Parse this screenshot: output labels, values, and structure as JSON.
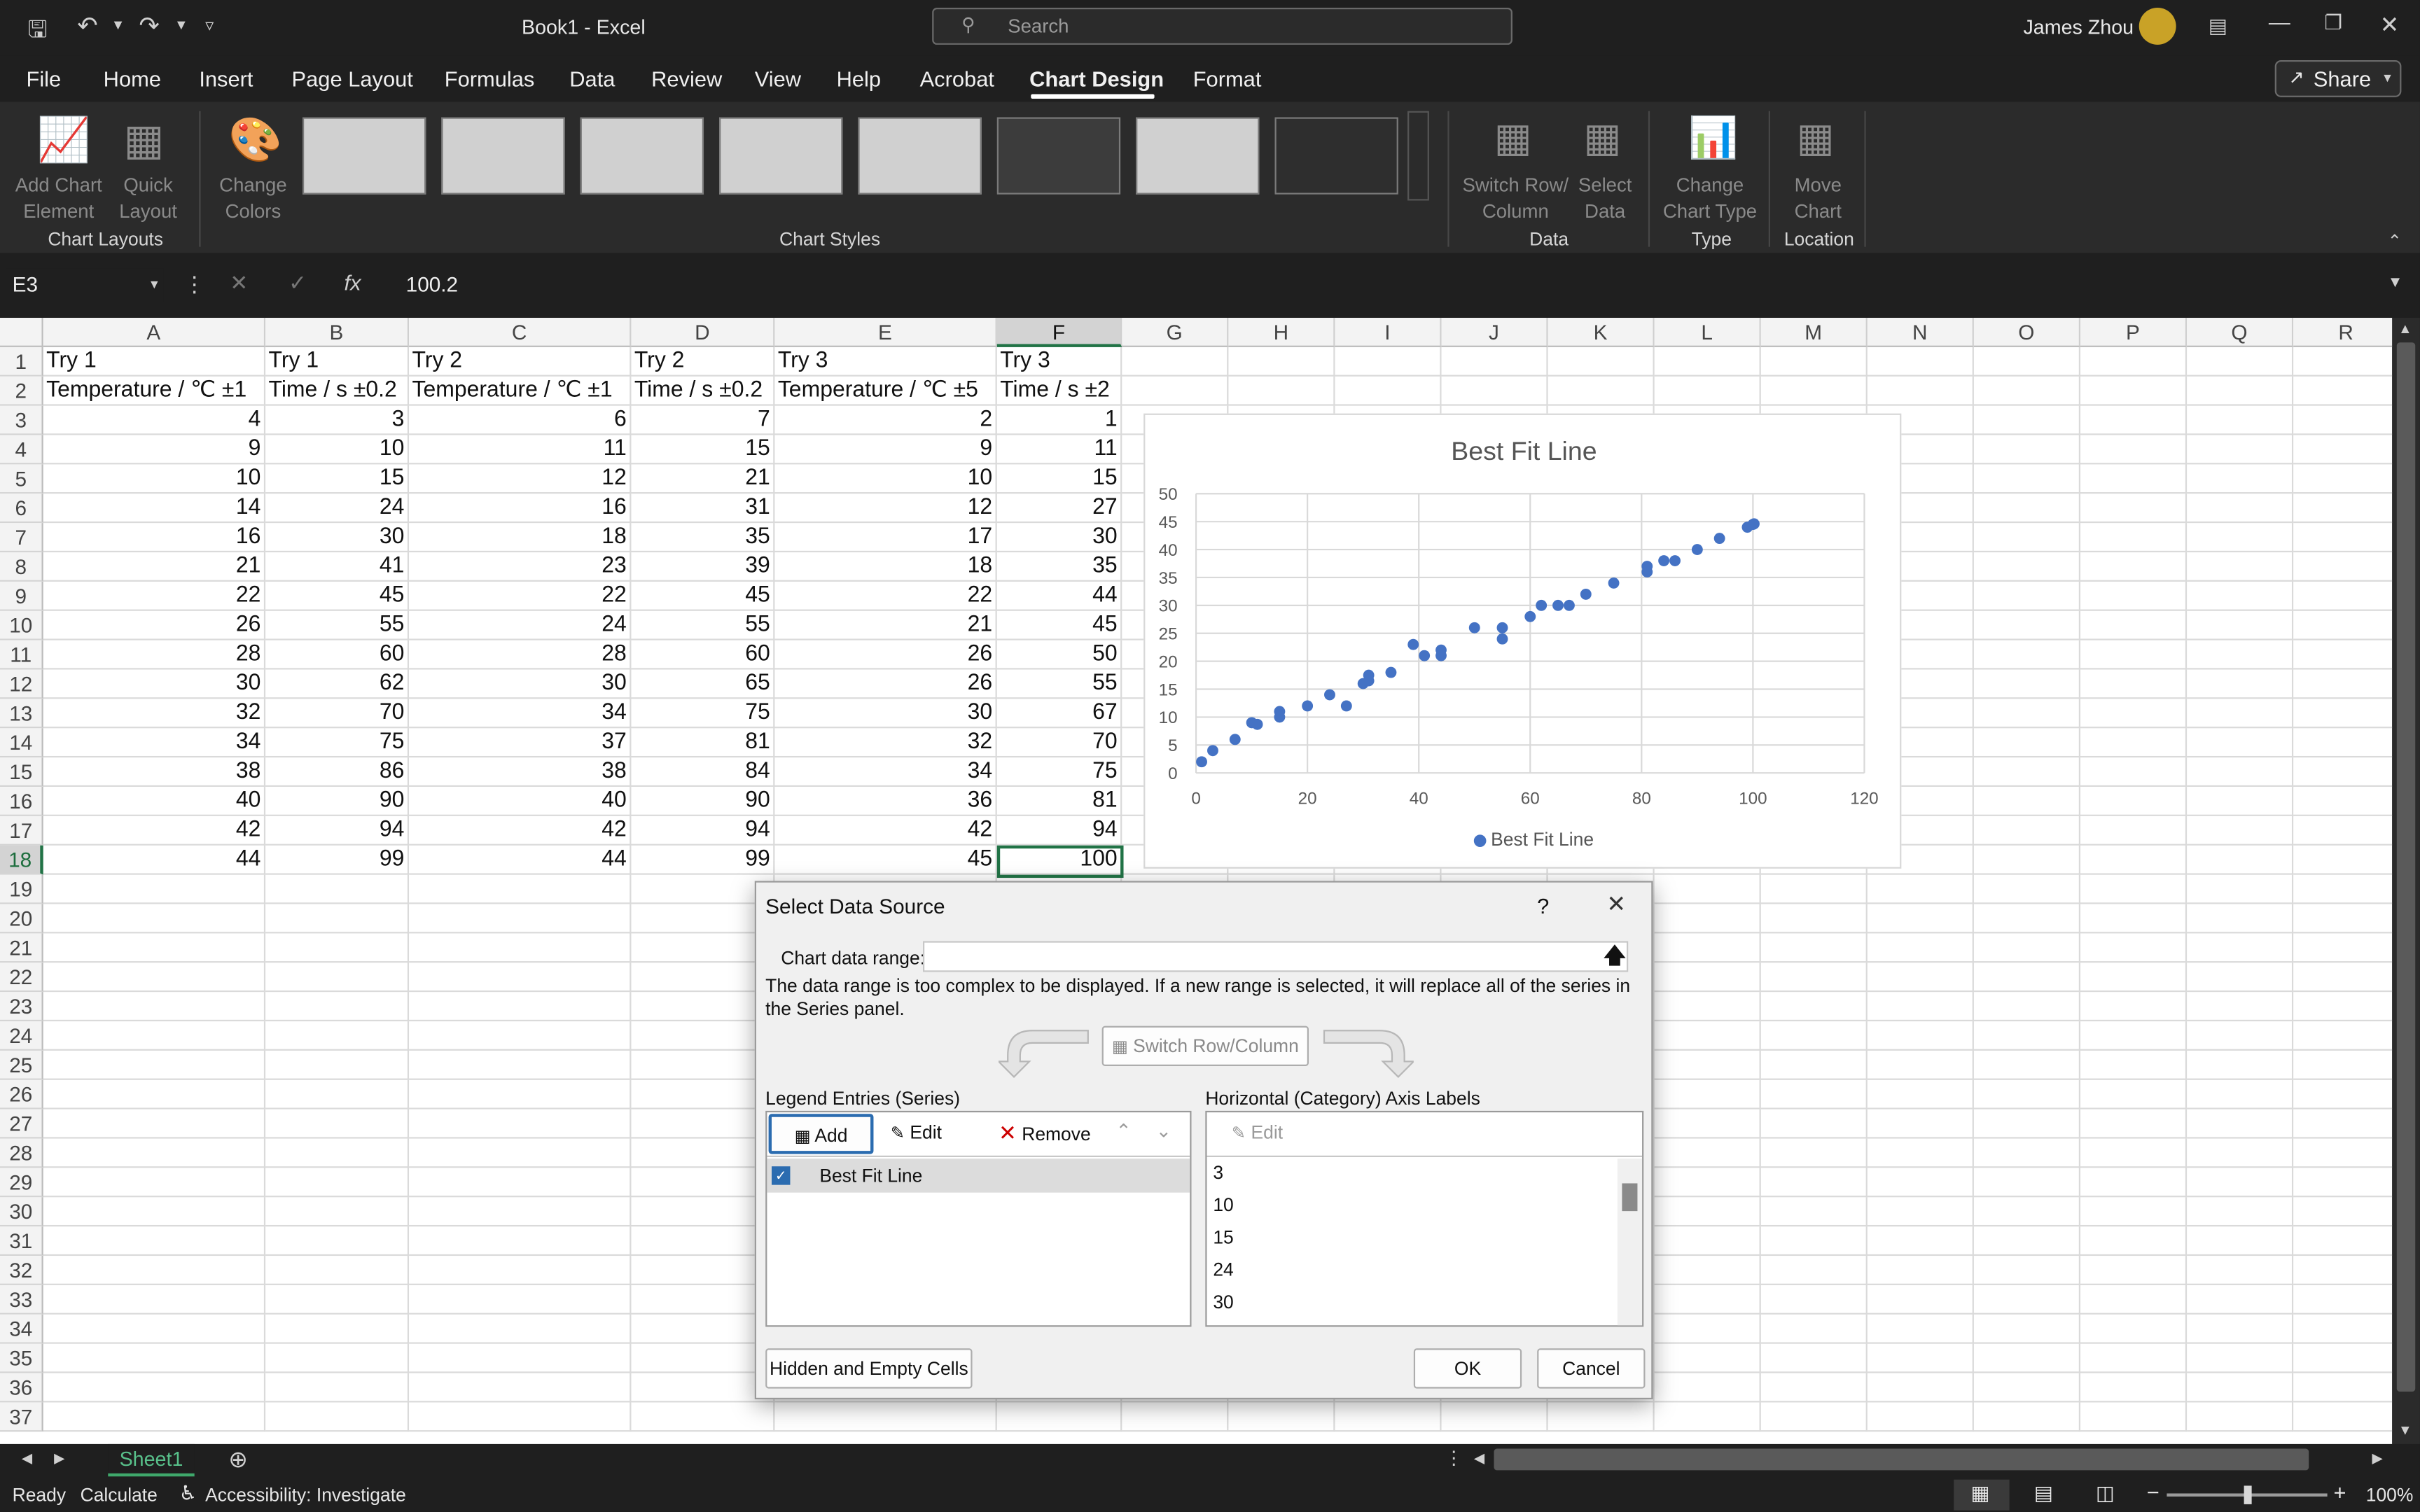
{
  "titlebar": {
    "doc_title": "Book1  -  Excel",
    "search_placeholder": "Search",
    "user_name": "James Zhou"
  },
  "menu": {
    "tabs": [
      "File",
      "Home",
      "Insert",
      "Page Layout",
      "Formulas",
      "Data",
      "Review",
      "View",
      "Help",
      "Acrobat",
      "Chart Design",
      "Format"
    ],
    "active": "Chart Design",
    "share": "Share"
  },
  "ribbon": {
    "add_chart_element": [
      "Add Chart",
      "Element"
    ],
    "quick_layout": [
      "Quick",
      "Layout"
    ],
    "change_colors": [
      "Change",
      "Colors"
    ],
    "switch_row_col": [
      "Switch Row/",
      "Column"
    ],
    "select_data": [
      "Select",
      "Data"
    ],
    "change_chart_type": [
      "Change",
      "Chart Type"
    ],
    "move_chart": [
      "Move",
      "Chart"
    ],
    "groups": {
      "chart_layouts": "Chart Layouts",
      "chart_styles": "Chart Styles",
      "data": "Data",
      "type": "Type",
      "location": "Location"
    }
  },
  "formula_bar": {
    "name_box": "E3",
    "formula": "100.2"
  },
  "sheet": {
    "columns": [
      "A",
      "B",
      "C",
      "D",
      "E",
      "F",
      "G",
      "H",
      "I",
      "J",
      "K",
      "L",
      "M",
      "N",
      "O",
      "P",
      "Q",
      "R"
    ],
    "selected_column": "F",
    "selected_row": "18",
    "rows": [
      "1",
      "2",
      "3",
      "4",
      "5",
      "6",
      "7",
      "8",
      "9",
      "10",
      "11",
      "12",
      "13",
      "14",
      "15",
      "16",
      "17",
      "18",
      "19",
      "20",
      "21",
      "22",
      "23",
      "24",
      "25",
      "26",
      "27",
      "28",
      "29",
      "30",
      "31",
      "32",
      "33",
      "34",
      "35",
      "36",
      "37"
    ],
    "header_row1": [
      "Try 1",
      "Try 1",
      "Try 2",
      "Try 2",
      "Try 3",
      "Try 3"
    ],
    "header_row2": [
      "Temperature / ℃ ±1",
      "Time / s ±0.2",
      "Temperature / ℃ ±1",
      "Time / s ±0.2",
      "Temperature / ℃ ±5",
      "Time / s ±2"
    ],
    "data": [
      [
        4,
        3,
        6,
        7,
        2,
        1
      ],
      [
        9,
        10,
        11,
        15,
        9,
        11
      ],
      [
        10,
        15,
        12,
        21,
        10,
        15
      ],
      [
        14,
        24,
        16,
        31,
        12,
        27
      ],
      [
        16,
        30,
        18,
        35,
        17,
        30
      ],
      [
        21,
        41,
        23,
        39,
        18,
        35
      ],
      [
        22,
        45,
        22,
        45,
        22,
        44
      ],
      [
        26,
        55,
        24,
        55,
        21,
        45
      ],
      [
        28,
        60,
        28,
        60,
        26,
        50
      ],
      [
        30,
        62,
        30,
        65,
        26,
        55
      ],
      [
        32,
        70,
        34,
        75,
        30,
        67
      ],
      [
        34,
        75,
        37,
        81,
        32,
        70
      ],
      [
        38,
        86,
        38,
        84,
        34,
        75
      ],
      [
        40,
        90,
        40,
        90,
        36,
        81
      ],
      [
        42,
        94,
        42,
        94,
        42,
        94
      ],
      [
        44,
        99,
        44,
        99,
        45,
        100
      ]
    ],
    "sheet_tab": "Sheet1"
  },
  "chart_data": {
    "type": "scatter",
    "title": "Best Fit Line",
    "xlim": [
      0,
      120
    ],
    "ylim": [
      0,
      50
    ],
    "x_ticks": [
      "0",
      "20",
      "40",
      "60",
      "80",
      "100",
      "120"
    ],
    "y_ticks": [
      "0",
      "5",
      "10",
      "15",
      "20",
      "25",
      "30",
      "35",
      "40",
      "45",
      "50"
    ],
    "grid": true,
    "legend_position": "bottom",
    "series": [
      {
        "name": "Best Fit Line",
        "color": "#4472c4",
        "points": [
          [
            1,
            2
          ],
          [
            3,
            4
          ],
          [
            7,
            6
          ],
          [
            10,
            9
          ],
          [
            11,
            8.7
          ],
          [
            15,
            10
          ],
          [
            15,
            11
          ],
          [
            20,
            12
          ],
          [
            24,
            14
          ],
          [
            27,
            12
          ],
          [
            30,
            16
          ],
          [
            31,
            17.5
          ],
          [
            31,
            16.5
          ],
          [
            35,
            18
          ],
          [
            39,
            23
          ],
          [
            41,
            21
          ],
          [
            44,
            22
          ],
          [
            44,
            21
          ],
          [
            50,
            26
          ],
          [
            55,
            24
          ],
          [
            55,
            26
          ],
          [
            60,
            28
          ],
          [
            62,
            30
          ],
          [
            65,
            30
          ],
          [
            67,
            30
          ],
          [
            70,
            32
          ],
          [
            75,
            34
          ],
          [
            81,
            36
          ],
          [
            81,
            37
          ],
          [
            84,
            38
          ],
          [
            86,
            38
          ],
          [
            90,
            40
          ],
          [
            94,
            42
          ],
          [
            99,
            44
          ],
          [
            100,
            44.5
          ],
          [
            100.2,
            44.6
          ]
        ]
      }
    ]
  },
  "dialog": {
    "title": "Select Data Source",
    "help": "?",
    "chart_data_range_label": "Chart data range:",
    "message": "The data range is too complex to be displayed. If a new range is selected, it will replace all of the series in the Series panel.",
    "switch_row_column": "Switch Row/Column",
    "legend_entries_label": "Legend Entries (Series)",
    "axis_labels_label": "Horizontal (Category) Axis Labels",
    "add": "Add",
    "edit": "Edit",
    "remove": "Remove",
    "axis_edit": "Edit",
    "series": [
      "Best Fit Line"
    ],
    "axis_values": [
      "3",
      "10",
      "15",
      "24",
      "30"
    ],
    "hidden_empty": "Hidden and Empty Cells",
    "ok": "OK",
    "cancel": "Cancel"
  },
  "status": {
    "ready": "Ready",
    "calculate": "Calculate",
    "accessibility": "Accessibility: Investigate",
    "zoom": "100%"
  }
}
